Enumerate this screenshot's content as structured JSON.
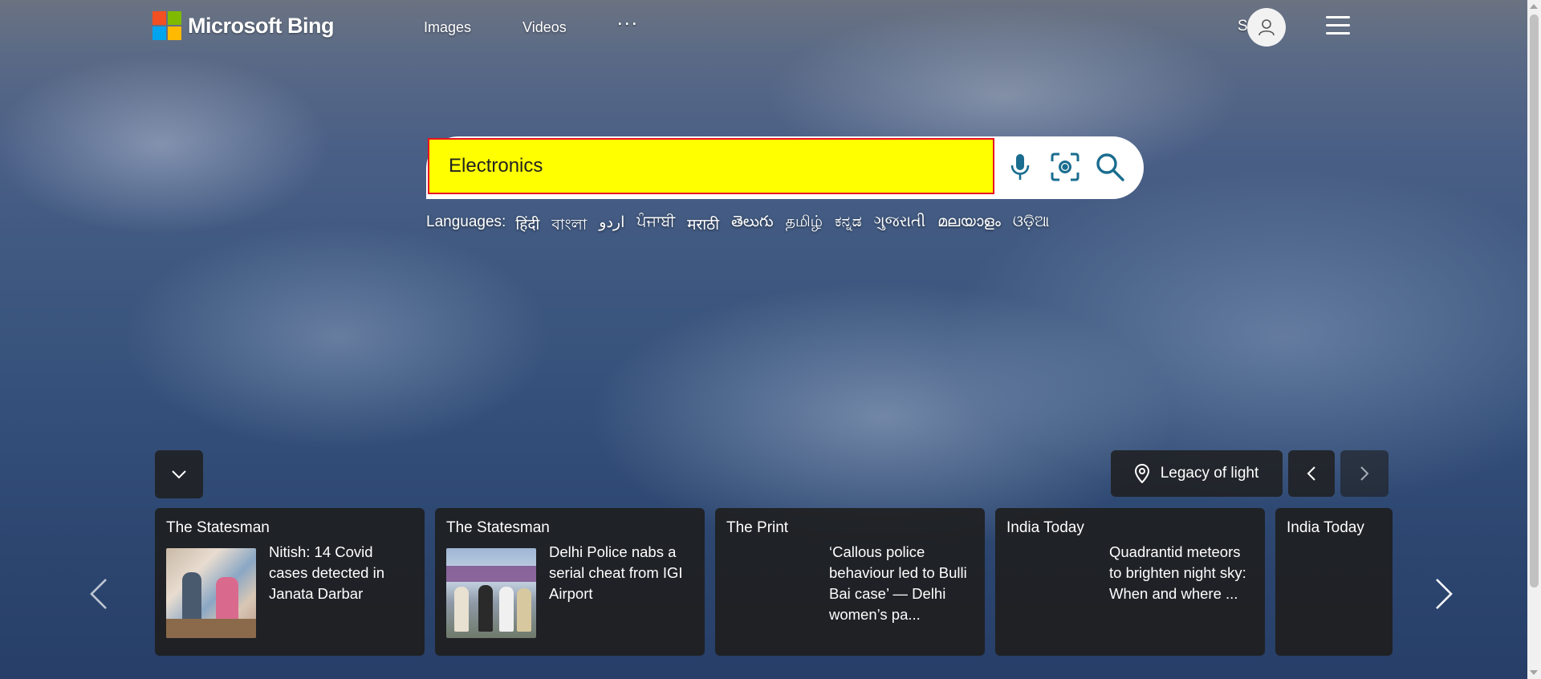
{
  "brand": {
    "name": "Microsoft Bing"
  },
  "nav": {
    "items": [
      "Images",
      "Videos"
    ],
    "more_label": "···"
  },
  "header": {
    "signin_label": "Sign in"
  },
  "search": {
    "value": "Electronics"
  },
  "languages": {
    "label": "Languages:",
    "items": [
      "हिंदी",
      "বাংলা",
      "اردو",
      "ਪੰਜਾਬੀ",
      "मराठी",
      "తెలుగు",
      "தமிழ்",
      "ಕನ್ನಡ",
      "ગુજરાતી",
      "മലയാളം",
      "ଓଡ଼ିଆ"
    ]
  },
  "image_info": {
    "title": "Legacy of light"
  },
  "news": [
    {
      "source": "The Statesman",
      "headline": "Nitish: 14 Covid cases detected in Janata Darbar",
      "has_image": true
    },
    {
      "source": "The Statesman",
      "headline": "Delhi Police nabs a serial cheat from IGI Airport",
      "has_image": true
    },
    {
      "source": "The Print",
      "headline": "‘Callous police behaviour led to Bulli Bai case’ — Delhi women’s pa...",
      "has_image": false
    },
    {
      "source": "India Today",
      "headline": "Quadrantid meteors to brighten night sky: When and where ...",
      "has_image": false
    },
    {
      "source": "India Today",
      "headline": "",
      "has_image": false
    }
  ],
  "colors": {
    "search_highlight": "#ffff00",
    "search_border": "#e81123",
    "icon_teal": "#174ae4"
  }
}
